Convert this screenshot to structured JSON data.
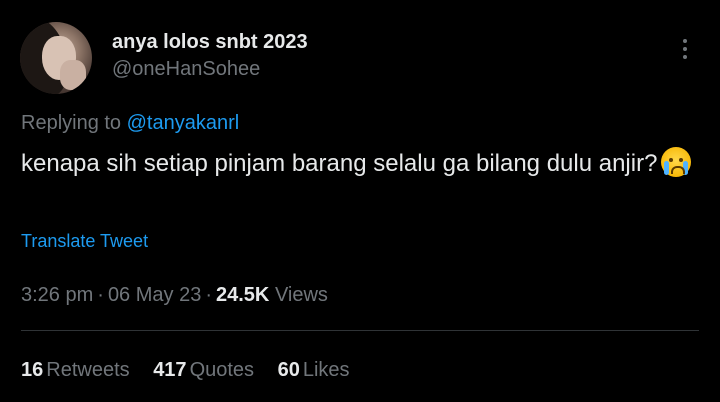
{
  "author": {
    "display_name": "anya lolos snbt 2023",
    "handle": "@oneHanSohee"
  },
  "reply": {
    "prefix": "Replying to",
    "mention": "@tanyakanrl"
  },
  "tweet": {
    "text": "kenapa sih setiap pinjam barang selalu ga bilang dulu anjir?",
    "emoji": "loudly-crying-face"
  },
  "translate_label": "Translate Tweet",
  "meta": {
    "time": "3:26 pm",
    "separator": "·",
    "date": "06 May 23",
    "views_count": "24.5K",
    "views_label": "Views"
  },
  "stats": [
    {
      "count": "16",
      "label": "Retweets"
    },
    {
      "count": "417",
      "label": "Quotes"
    },
    {
      "count": "60",
      "label": "Likes"
    }
  ],
  "colors": {
    "background": "#000000",
    "primary_text": "#e7e9ea",
    "secondary_text": "#71767b",
    "accent": "#1d9bf0",
    "divider": "#2f3336"
  }
}
